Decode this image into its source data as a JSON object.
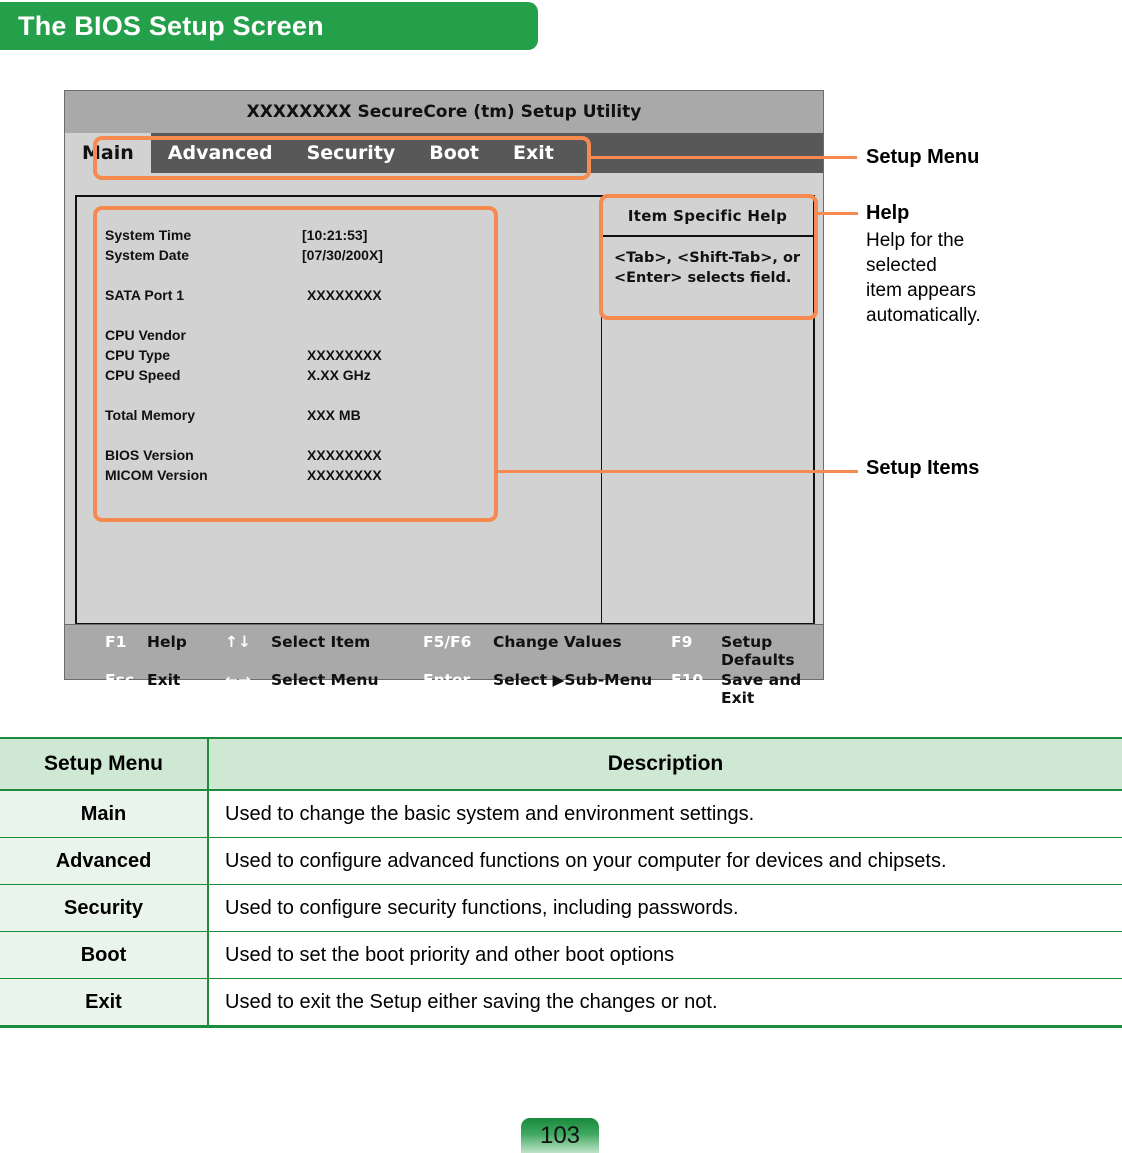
{
  "page": {
    "heading": "The BIOS Setup Screen",
    "number": "103"
  },
  "bios": {
    "title": "XXXXXXXX SecureCore (tm) Setup Utility",
    "tabs": [
      {
        "label": "Main",
        "active": true
      },
      {
        "label": "Advanced",
        "active": false
      },
      {
        "label": "Security",
        "active": false
      },
      {
        "label": "Boot",
        "active": false
      },
      {
        "label": "Exit",
        "active": false
      }
    ],
    "setup_items": [
      {
        "label": "System Time",
        "value": "[10:21:53]"
      },
      {
        "label": "System Date",
        "value": "[07/30/200X]"
      },
      {
        "label": "SATA Port 1",
        "value": "XXXXXXXX"
      },
      {
        "label": "CPU Vendor",
        "value": ""
      },
      {
        "label": "CPU Type",
        "value": "XXXXXXXX"
      },
      {
        "label": "CPU Speed",
        "value": "X.XX GHz"
      },
      {
        "label": "Total Memory",
        "value": "XXX MB"
      },
      {
        "label": "BIOS Version",
        "value": "XXXXXXXX"
      },
      {
        "label": "MICOM Version",
        "value": "XXXXXXXX"
      }
    ],
    "help": {
      "title": "Item Specific Help",
      "line1": "<Tab>, <Shift-Tab>, or",
      "line2": "<Enter> selects field."
    },
    "footer": [
      {
        "key": "F1",
        "desc": "Help"
      },
      {
        "key": "↑↓",
        "desc": "Select Item"
      },
      {
        "key": "F5/F6",
        "desc": "Change Values"
      },
      {
        "key": "F9",
        "desc": "Setup Defaults"
      },
      {
        "key": "Esc",
        "desc": "Exit"
      },
      {
        "key": "←→",
        "desc": "Select Menu"
      },
      {
        "key": "Enter",
        "desc": "Select ▶Sub-Menu"
      },
      {
        "key": "F10",
        "desc": "Save and Exit"
      }
    ]
  },
  "annotations": [
    {
      "title": "Setup Menu",
      "desc": ""
    },
    {
      "title": "Help",
      "desc": "Help for the\nselected\nitem appears\nautomatically."
    },
    {
      "title": "Setup Items",
      "desc": ""
    }
  ],
  "table": {
    "headers": [
      "Setup Menu",
      "Description"
    ],
    "rows": [
      {
        "menu": "Main",
        "desc": "Used to change the basic system and environment settings."
      },
      {
        "menu": "Advanced",
        "desc": "Used to configure advanced functions on your computer for devices and chipsets."
      },
      {
        "menu": "Security",
        "desc": "Used to configure security functions, including passwords."
      },
      {
        "menu": "Boot",
        "desc": "Used to set the boot priority and other boot options"
      },
      {
        "menu": "Exit",
        "desc": "Used to exit the Setup either saving the changes or not."
      }
    ]
  },
  "colors": {
    "brand_green": "#25a04a",
    "table_border_green": "#1e8a3c",
    "table_header_bg": "#cfe8d3",
    "table_menu_bg": "#e9f4ec",
    "callout_orange": "#f68a4f",
    "bios_bg": "#d2d2d2",
    "bios_titlebar": "#a9a9a9",
    "bios_menubar": "#585858"
  }
}
